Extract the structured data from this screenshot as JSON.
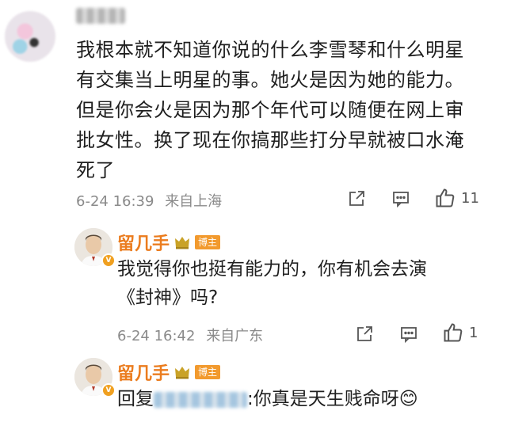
{
  "top_comment": {
    "text": "我根本就不知道你说的什么李雪琴和什么明星\n有交集当上明星的事。她火是因为她的能力。\n但是你会火是因为那个年代可以随便在网上审\n批女性。换了现在你搞那些打分早就被口水淹\n死了",
    "time": "6-24 16:39",
    "location": "来自上海",
    "like_count": "11"
  },
  "reply1": {
    "name": "留几手",
    "badge": "博主",
    "text": "我觉得你也挺有能力的，你有机会去演\n《封神》吗?",
    "time": "6-24 16:42",
    "location": "来自广东",
    "like_count": "1"
  },
  "reply2": {
    "name": "留几手",
    "badge": "博主",
    "prefix": "回复",
    "text": ":你真是天生贱命呀",
    "emoji": "😊"
  },
  "colors": {
    "name_orange": "#eb7c1e",
    "meta_gray": "#8a8a8a",
    "badge_orange": "#f29a2e"
  }
}
